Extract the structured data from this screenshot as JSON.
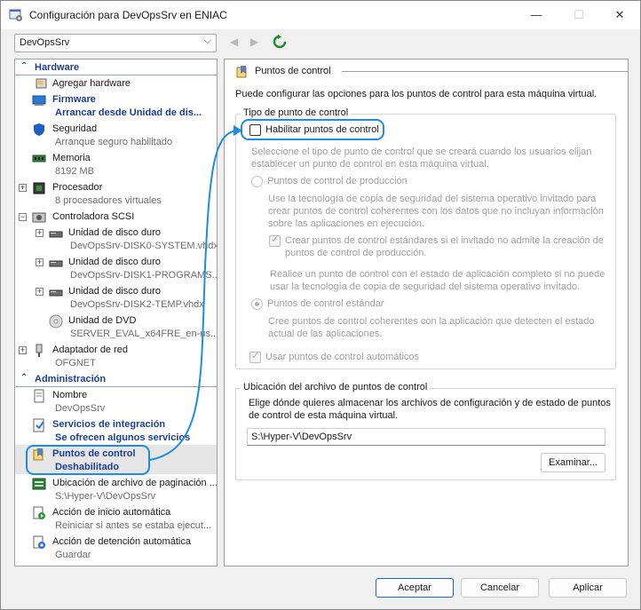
{
  "window": {
    "title": "Configuración para DevOpsSrv en ENIAC",
    "minimize": "—",
    "maximize": "☐",
    "close": "✕"
  },
  "toolbar": {
    "vm_name": "DevOpsSrv",
    "back": "◀",
    "forward": "▶"
  },
  "hardware_section": "Hardware",
  "admin_section": "Administración",
  "hardware_items": [
    {
      "title": "Agregar hardware",
      "subtitle": ""
    },
    {
      "title": "Firmware",
      "subtitle": "Arrancar desde Unidad de dis..."
    },
    {
      "title": "Seguridad",
      "subtitle": "Arranque seguro habilitado"
    },
    {
      "title": "Memoria",
      "subtitle": "8192 MB"
    },
    {
      "title": "Procesador",
      "subtitle": "8 procesadores virtuales"
    },
    {
      "title": "Controladora SCSI",
      "subtitle": ""
    },
    {
      "title": "Unidad de disco duro",
      "subtitle": "DevOpsSrv-DISK0-SYSTEM.vhdx"
    },
    {
      "title": "Unidad de disco duro",
      "subtitle": "DevOpsSrv-DISK1-PROGRAMS..."
    },
    {
      "title": "Unidad de disco duro",
      "subtitle": "DevOpsSrv-DISK2-TEMP.vhdx"
    },
    {
      "title": "Unidad de DVD",
      "subtitle": "SERVER_EVAL_x64FRE_en-us...."
    },
    {
      "title": "Adaptador de red",
      "subtitle": "OFGNET"
    }
  ],
  "admin_items": [
    {
      "title": "Nombre",
      "subtitle": "DevOpsSrv"
    },
    {
      "title": "Servicios de integración",
      "subtitle": "Se ofrecen algunos servicios"
    },
    {
      "title": "Puntos de control",
      "subtitle": "Deshabilitado"
    },
    {
      "title": "Ubicación de archivo de paginación ...",
      "subtitle": "S:\\Hyper-V\\DevOpsSrv"
    },
    {
      "title": "Acción de inicio automática",
      "subtitle": "Reiniciar si antes se estaba ejecut..."
    },
    {
      "title": "Acción de detención automática",
      "subtitle": "Guardar"
    }
  ],
  "panel": {
    "header": "Puntos de control",
    "description": "Puede configurar las opciones para los puntos de control para esta máquina virtual.",
    "type_group": "Tipo de punto de control",
    "enable_label": "Habilitar puntos de control",
    "enable_desc": [
      "Seleccione el tipo de punto de control que se creará cuando los usuarios elijan",
      "establecer un punto de control en esta máquina virtual."
    ],
    "production_label": "Puntos de control de producción",
    "production_desc": [
      "Use la tecnología de copia de seguridad del sistema operativo invitado para",
      "crear puntos de control coherentes con los datos que no incluyan información",
      "sobre las aplicaciones en ejecución."
    ],
    "fallback_label": [
      "Crear puntos de control estándares si el invitado no admite la creación de",
      "puntos de control de producción."
    ],
    "fallback_desc": [
      "Realice un punto de control con el estado de aplicación completo si no puede",
      "usar la tecnología de copia de seguridad del sistema operativo invitado."
    ],
    "standard_label": "Puntos de control estándar",
    "standard_desc": [
      "Cree puntos de control coherentes con la aplicación que detecten el estado",
      "actual de las aplicaciones."
    ],
    "auto_label": "Usar puntos de control automáticos",
    "location_group": "Ubicación del archivo de puntos de control",
    "location_desc": [
      "Elige dónde quieres almacenar los archivos de configuración y de estado de puntos",
      "de control de esta máquina virtual."
    ],
    "location_path": "S:\\Hyper-V\\DevOpsSrv",
    "browse": "Examinar..."
  },
  "footer": {
    "accept": "Aceptar",
    "cancel": "Cancelar",
    "apply": "Aplicar"
  },
  "colors": {
    "accent_link": "#1c3f94",
    "callout": "#1e8ce0",
    "selection": "#e6e6e6"
  }
}
